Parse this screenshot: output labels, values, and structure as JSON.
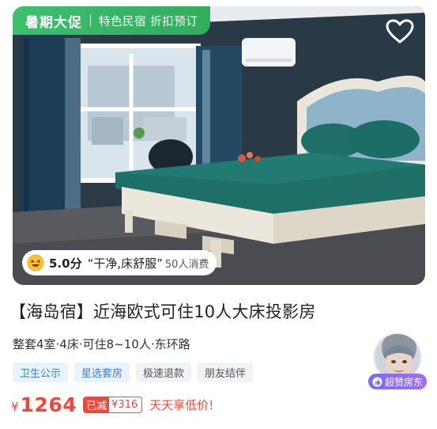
{
  "promo": {
    "main": "暑期大促",
    "sub": "特色民宿 折扣预订"
  },
  "rating": {
    "score": "5.0分",
    "quote": "“干净,床舒服”",
    "count": "50人消费"
  },
  "listing": {
    "title": "【海岛宿】近海欧式可住10人大床投影房",
    "subtitle": "整套4室·4床·可住8~10人·东环路",
    "tags": [
      "卫生公示",
      "星选套房",
      "极速退款",
      "朋友结伴"
    ]
  },
  "price": {
    "currency": "¥",
    "amount": "1264",
    "discount_label": "已减",
    "discount_value": "¥316",
    "promo_text": "天天享低价!"
  },
  "host": {
    "badge": "超赞房东"
  },
  "icons": {
    "favorite": "heart-outline-icon",
    "rating": "smile-emoji-icon",
    "host_badge": "thumb-up-icon"
  },
  "colors": {
    "promo_green": "#3dbf6e",
    "price_red": "#f3463a",
    "tag_blue": "#3d7fe0",
    "host_purple": "#8a6cf0"
  }
}
